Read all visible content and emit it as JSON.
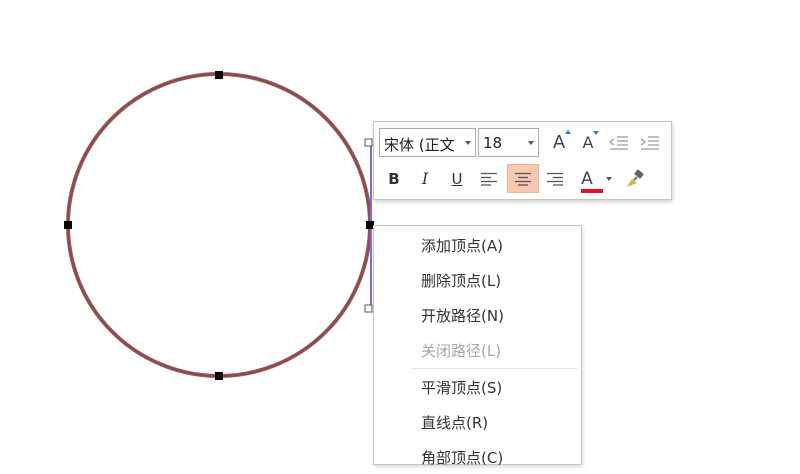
{
  "mini_toolbar": {
    "font_name": "宋体 (正文",
    "font_size": "18",
    "font_color": "#e81123",
    "buttons": {
      "grow_font": "A",
      "shrink_font": "A",
      "bold": "B",
      "italic": "I",
      "underline": "U",
      "font_color": "A"
    }
  },
  "context_menu": {
    "items": [
      {
        "label": "添加顶点(A)",
        "disabled": false
      },
      {
        "label": "删除顶点(L)",
        "disabled": false
      },
      {
        "label": "开放路径(N)",
        "disabled": false
      },
      {
        "label": "关闭路径(L)",
        "disabled": true
      },
      {
        "label": "平滑顶点(S)",
        "disabled": false
      },
      {
        "label": "直线点(R)",
        "disabled": false
      },
      {
        "label": "角部顶点(C)",
        "disabled": false
      }
    ]
  },
  "shape": {
    "outline_color": "#b03a3a",
    "selection_color": "#7b6ee6"
  }
}
